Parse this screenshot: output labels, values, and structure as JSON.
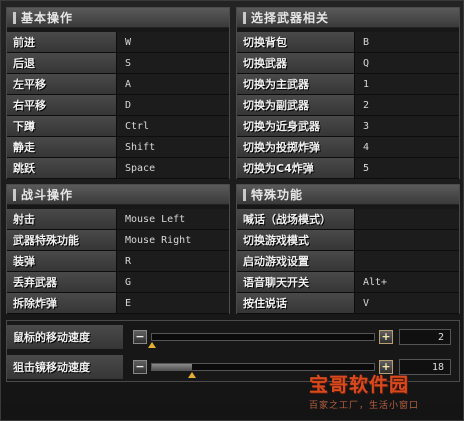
{
  "panels": {
    "basic": {
      "title": "基本操作",
      "rows": [
        {
          "label": "前进",
          "key": "W"
        },
        {
          "label": "后退",
          "key": "S"
        },
        {
          "label": "左平移",
          "key": "A"
        },
        {
          "label": "右平移",
          "key": "D"
        },
        {
          "label": "下蹲",
          "key": "Ctrl"
        },
        {
          "label": "静走",
          "key": "Shift"
        },
        {
          "label": "跳跃",
          "key": "Space"
        }
      ]
    },
    "weapon": {
      "title": "选择武器相关",
      "rows": [
        {
          "label": "切换背包",
          "key": "B"
        },
        {
          "label": "切换武器",
          "key": "Q"
        },
        {
          "label": "切换为主武器",
          "key": "1"
        },
        {
          "label": "切换为副武器",
          "key": "2"
        },
        {
          "label": "切换为近身武器",
          "key": "3"
        },
        {
          "label": "切换为投掷炸弹",
          "key": "4"
        },
        {
          "label": "切换为C4炸弹",
          "key": "5"
        }
      ]
    },
    "combat": {
      "title": "战斗操作",
      "rows": [
        {
          "label": "射击",
          "key": "Mouse Left"
        },
        {
          "label": "武器特殊功能",
          "key": "Mouse Right"
        },
        {
          "label": "装弹",
          "key": "R"
        },
        {
          "label": "丢弃武器",
          "key": "G"
        },
        {
          "label": "拆除炸弹",
          "key": "E"
        }
      ]
    },
    "special": {
      "title": "特殊功能",
      "rows": [
        {
          "label": "喊话（战场模式）",
          "key": ""
        },
        {
          "label": "切换游戏模式",
          "key": ""
        },
        {
          "label": "启动游戏设置",
          "key": ""
        },
        {
          "label": "语音聊天开关",
          "key": "Alt+"
        },
        {
          "label": "按住说话",
          "key": "V"
        }
      ]
    }
  },
  "sliders": [
    {
      "label": "鼠标的移动速度",
      "value": "2",
      "level": 0.0
    },
    {
      "label": "狙击镜移动速度",
      "value": "18",
      "level": 0.18
    }
  ],
  "buttons": {
    "minus": "−",
    "plus": "+"
  },
  "watermark": {
    "main": "宝哥软件园",
    "sub": "百家之工厂，生活小窗口"
  }
}
